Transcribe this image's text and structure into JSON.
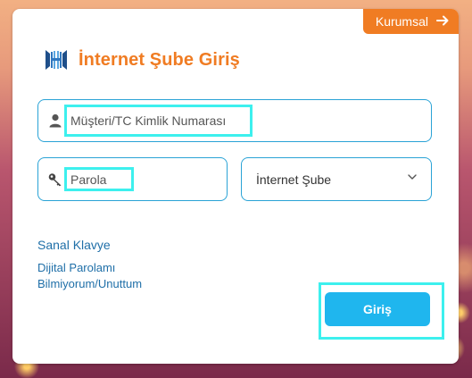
{
  "corporate_button": {
    "label": "Kurumsal",
    "icon": "arrow-right-icon"
  },
  "header": {
    "title": "İnternet Şube Giriş",
    "logo": "bank-logo-icon"
  },
  "form": {
    "customer_id": {
      "placeholder": "Müşteri/TC Kimlik Numarası",
      "value": "",
      "icon": "user-icon"
    },
    "password": {
      "placeholder": "Parola",
      "value": "",
      "icon": "key-icon"
    },
    "channel_select": {
      "selected": "İnternet Şube",
      "icon": "chevron-down-icon"
    }
  },
  "links": {
    "virtual_keyboard": "Sanal Klavye",
    "forgot_line1": "Dijital Parolamı",
    "forgot_line2": "Bilmiyorum/Unuttum"
  },
  "submit": {
    "label": "Giriş"
  },
  "colors": {
    "brand_orange": "#f07c23",
    "accent_blue": "#1fb6ee",
    "highlight_cyan": "#3df0ee",
    "link_blue": "#1f6fa8"
  }
}
